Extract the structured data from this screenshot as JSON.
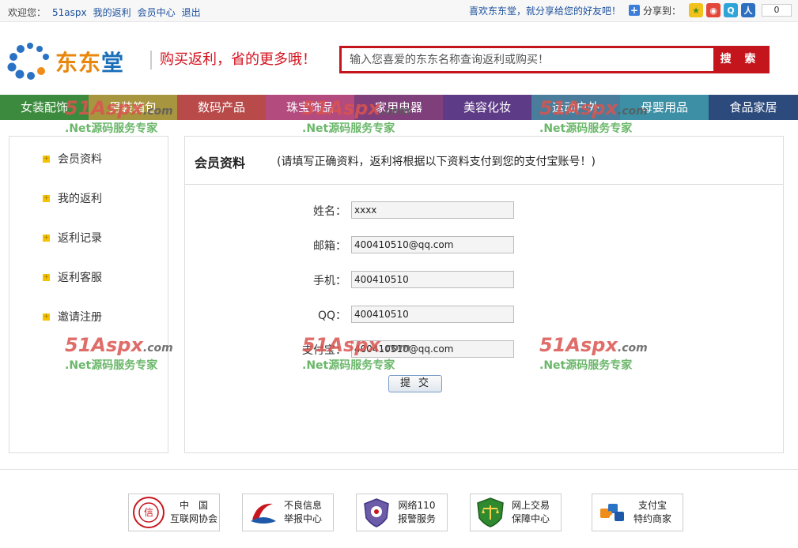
{
  "topbar": {
    "greeting": "欢迎您：",
    "username": "51aspx",
    "links": [
      "我的返利",
      "会员中心",
      "退出"
    ],
    "recommend": "喜欢东东堂，就分享给您的好友吧！",
    "share_label": "分享到：",
    "share_count": "0"
  },
  "header": {
    "logo_text_a": "东东",
    "logo_text_b": "堂",
    "slogan": "购买返利，省的更多哦！",
    "search_placeholder": "输入您喜爱的东东名称查询返利或购买！",
    "search_button": "搜 索"
  },
  "nav": {
    "items": [
      {
        "label": "女装配饰",
        "color": "#3c8a3d"
      },
      {
        "label": "男装箱包",
        "color": "#a8953f"
      },
      {
        "label": "数码产品",
        "color": "#b84a4a"
      },
      {
        "label": "珠宝饰品",
        "color": "#b34b7f"
      },
      {
        "label": "家用电器",
        "color": "#7e3f7a"
      },
      {
        "label": "美容化妆",
        "color": "#5e3b86"
      },
      {
        "label": "运动户外",
        "color": "#4a7d9b"
      },
      {
        "label": "母婴用品",
        "color": "#3c8fa4"
      },
      {
        "label": "食品家居",
        "color": "#2c4a7c"
      }
    ]
  },
  "sidebar": {
    "items": [
      "会员资料",
      "我的返利",
      "返利记录",
      "返利客服",
      "邀请注册"
    ]
  },
  "panel": {
    "title": "会员资料",
    "note": "(请填写正确资料，返利将根据以下资料支付到您的支付宝账号！)",
    "fields": [
      {
        "label": "姓名：",
        "value": "xxxx"
      },
      {
        "label": "邮箱：",
        "value": "400410510@qq.com"
      },
      {
        "label": "手机：",
        "value": "400410510"
      },
      {
        "label": "QQ：",
        "value": "400410510"
      },
      {
        "label": "支付宝：",
        "value": "400410510@qq.com"
      }
    ],
    "submit": "提交"
  },
  "footer": {
    "badges": [
      {
        "line1": "中　国",
        "line2": "互联网协会"
      },
      {
        "line1": "不良信息",
        "line2": "举报中心"
      },
      {
        "line1": "网络110",
        "line2": "报警服务"
      },
      {
        "line1": "网上交易",
        "line2": "保障中心"
      },
      {
        "line1": "支付宝",
        "line2": "特约商家"
      }
    ]
  },
  "watermark": {
    "brand": "51Aspx",
    "suffix": ".com",
    "tagline": ".Net源码服务专家"
  },
  "colors": {
    "accent_red": "#c4141c",
    "link_blue": "#1b4f9c",
    "bullet_yellow": "#f5c300"
  }
}
